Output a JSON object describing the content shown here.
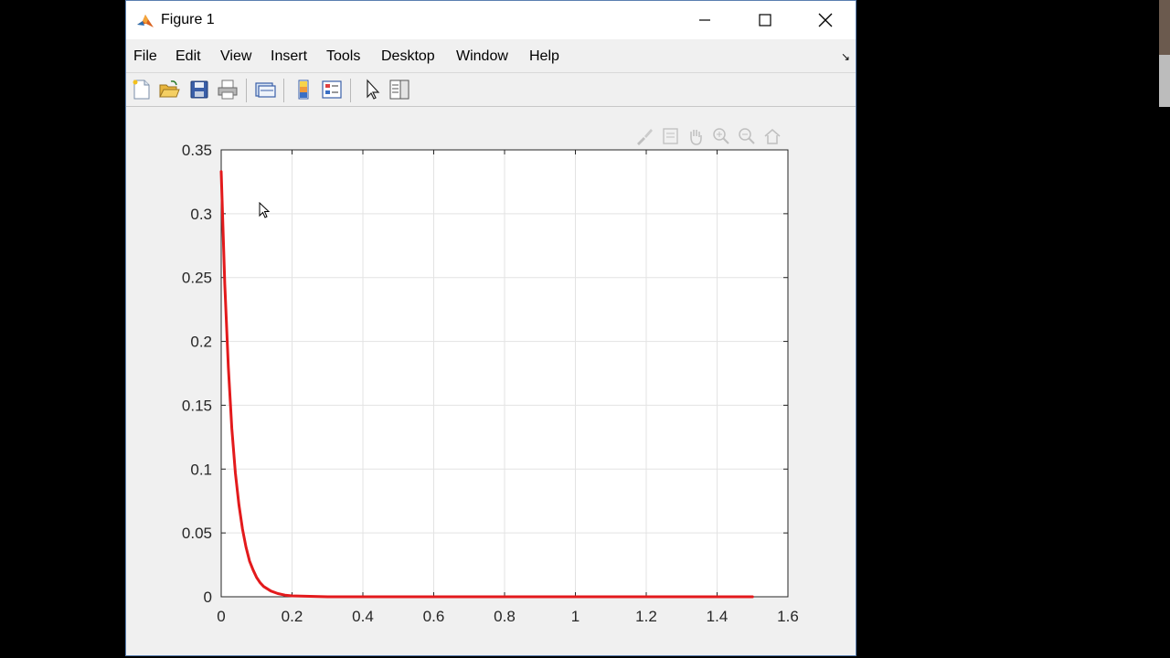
{
  "window": {
    "title": "Figure 1"
  },
  "menu": [
    "File",
    "Edit",
    "View",
    "Insert",
    "Tools",
    "Desktop",
    "Window",
    "Help"
  ],
  "chart_data": {
    "type": "line",
    "xlim": [
      0,
      1.6
    ],
    "ylim": [
      0,
      0.35
    ],
    "xticks": [
      0,
      0.2,
      0.4,
      0.6,
      0.8,
      1,
      1.2,
      1.4,
      1.6
    ],
    "yticks": [
      0,
      0.05,
      0.1,
      0.15,
      0.2,
      0.25,
      0.3,
      0.35
    ],
    "xtick_labels": [
      "0",
      "0.2",
      "0.4",
      "0.6",
      "0.8",
      "1",
      "1.2",
      "1.4",
      "1.6"
    ],
    "ytick_labels": [
      "0",
      "0.05",
      "0.1",
      "0.15",
      "0.2",
      "0.25",
      "0.3",
      "0.35"
    ],
    "grid": true,
    "series": [
      {
        "color": "#e31a1c",
        "x": [
          0,
          0.01,
          0.02,
          0.03,
          0.04,
          0.05,
          0.06,
          0.07,
          0.08,
          0.09,
          0.1,
          0.11,
          0.12,
          0.14,
          0.16,
          0.18,
          0.2,
          0.3,
          0.4,
          0.6,
          0.8,
          1.0,
          1.2,
          1.4,
          1.5
        ],
        "y": [
          0.333,
          0.245,
          0.18,
          0.132,
          0.097,
          0.072,
          0.053,
          0.039,
          0.028,
          0.021,
          0.015,
          0.011,
          0.008,
          0.0045,
          0.0025,
          0.0013,
          0.0007,
          0.0,
          0.0,
          0.0,
          0.0,
          0.0,
          0.0,
          0.0,
          0.0
        ]
      }
    ]
  }
}
